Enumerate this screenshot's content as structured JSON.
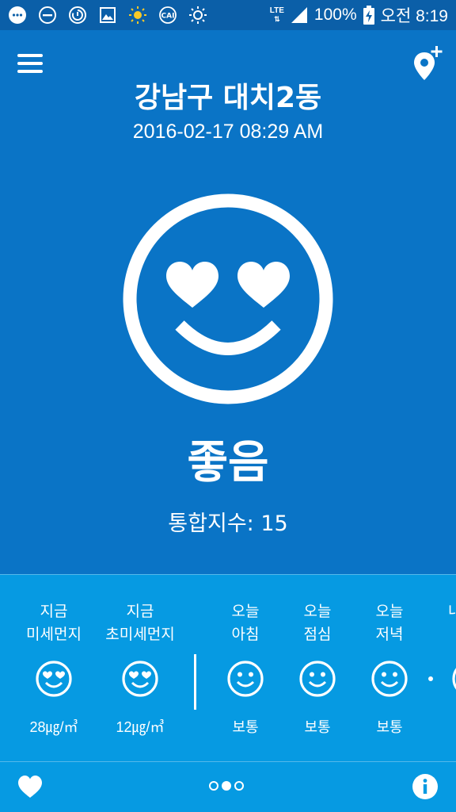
{
  "status_bar": {
    "network": "LTE",
    "battery": "100%",
    "time": "오전 8:19",
    "icons": [
      "chat-icon",
      "do-not-disturb-icon",
      "sync-icon",
      "image-icon",
      "sun-icon",
      "cai-icon",
      "brightness-icon"
    ],
    "cai_label": "CAI"
  },
  "header": {
    "location": "강남구 대치2동",
    "datetime": "2016-02-17 08:29 AM"
  },
  "current": {
    "status": "좋음",
    "index_text": "통합지수: 15",
    "face": "heart-eyes-face-icon"
  },
  "forecast": {
    "items": [
      {
        "line1": "지금",
        "line2": "미세먼지",
        "value": "28㎍/㎥",
        "face": "heart-eyes"
      },
      {
        "line1": "지금",
        "line2": "초미세먼지",
        "value": "12㎍/㎥",
        "face": "heart-eyes"
      },
      {
        "line1": "오늘",
        "line2": "아침",
        "value": "보통",
        "face": "smile"
      },
      {
        "line1": "오늘",
        "line2": "점심",
        "value": "보통",
        "face": "smile"
      },
      {
        "line1": "오늘",
        "line2": "저녁",
        "value": "보통",
        "face": "smile"
      }
    ],
    "partial_label": "내"
  },
  "bottom_bar": {
    "pages": 3,
    "active_page": 1
  },
  "colors": {
    "background": "#0a74c6",
    "status_bar": "#0b5fa8",
    "forecast_bg": "#069ae2"
  }
}
